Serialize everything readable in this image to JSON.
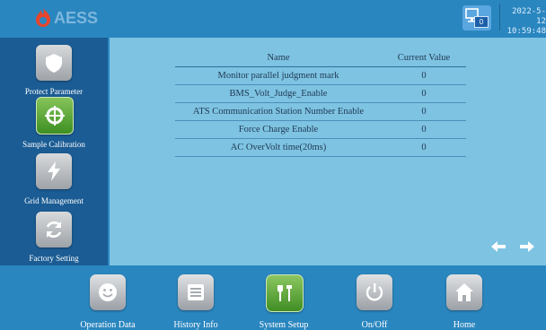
{
  "header": {
    "logo_text": "AESS",
    "network_badge": "0",
    "date": "2022-5-12",
    "time": "10:59:48"
  },
  "sidebar": {
    "items": [
      {
        "label": "Protect Parameter",
        "icon": "shield-icon",
        "active": false
      },
      {
        "label": "Sample Calibration",
        "icon": "crosshair-icon",
        "active": true
      },
      {
        "label": "Grid Management",
        "icon": "lightning-icon",
        "active": false
      },
      {
        "label": "Factory Setting",
        "icon": "refresh-icon",
        "active": false
      }
    ]
  },
  "table": {
    "headers": [
      "Name",
      "Current Value"
    ],
    "rows": [
      {
        "name": "Monitor parallel judgment mark",
        "value": "0"
      },
      {
        "name": "BMS_Volt_Judge_Enable",
        "value": "0"
      },
      {
        "name": "ATS Communication Station Number Enable",
        "value": "0"
      },
      {
        "name": "Force Charge Enable",
        "value": "0"
      },
      {
        "name": "AC OverVolt time(20ms)",
        "value": "0"
      }
    ]
  },
  "pager": {
    "prev_icon": "arrow-left-icon",
    "next_icon": "arrow-right-icon"
  },
  "bottom_nav": {
    "items": [
      {
        "label": "Operation Data",
        "icon": "smiley-icon",
        "active": false
      },
      {
        "label": "History Info",
        "icon": "document-icon",
        "active": false
      },
      {
        "label": "System Setup",
        "icon": "tools-icon",
        "active": true
      },
      {
        "label": "On/Off",
        "icon": "power-icon",
        "active": false
      },
      {
        "label": "Home",
        "icon": "home-icon",
        "active": false
      }
    ]
  },
  "colors": {
    "background": "#2a86bf",
    "sidebar": "#1b5c94",
    "panel": "#7ec3e2",
    "active_green": "#5aa83a",
    "logo_red": "#e8452c"
  }
}
